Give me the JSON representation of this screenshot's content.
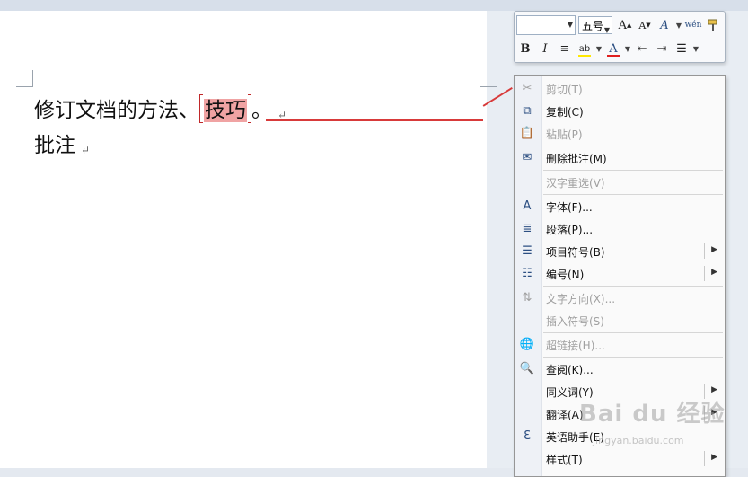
{
  "document": {
    "line1_before": "修订文档的方法、",
    "line1_highlight": "技巧",
    "line1_after": "。",
    "paragraph_mark": "↵",
    "line2": "批注"
  },
  "colors": {
    "comment_highlight": "#f0a3a3",
    "comment_line": "#d83a3a"
  },
  "mini_toolbar": {
    "font_name": "",
    "font_size": "五号",
    "grow_font": "A",
    "shrink_font": "A",
    "styles": "A",
    "phonetic": "wén",
    "format_painter_icon": "brush-icon",
    "bold": "B",
    "italic": "I",
    "center": "≡",
    "highlight": "ab",
    "font_color": "A",
    "decrease_indent": "⇤",
    "increase_indent": "⇥",
    "bullets": "☰"
  },
  "context_menu": {
    "items": [
      {
        "label": "剪切(T)",
        "icon": "scissors-icon",
        "glyph": "✂",
        "disabled": true
      },
      {
        "label": "复制(C)",
        "icon": "copy-icon",
        "glyph": "⧉",
        "disabled": false
      },
      {
        "label": "粘贴(P)",
        "icon": "paste-icon",
        "glyph": "📋",
        "disabled": true
      },
      {
        "label": "删除批注(M)",
        "icon": "delete-comment-icon",
        "glyph": "✉",
        "disabled": false
      },
      {
        "label": "汉字重选(V)",
        "icon": "",
        "glyph": "",
        "disabled": true
      },
      {
        "label": "字体(F)...",
        "icon": "font-icon",
        "glyph": "A",
        "disabled": false
      },
      {
        "label": "段落(P)...",
        "icon": "paragraph-icon",
        "glyph": "≣",
        "disabled": false
      },
      {
        "label": "项目符号(B)",
        "icon": "bullets-icon",
        "glyph": "☰",
        "disabled": false,
        "submenu": true
      },
      {
        "label": "编号(N)",
        "icon": "numbering-icon",
        "glyph": "☷",
        "disabled": false,
        "submenu": true
      },
      {
        "label": "文字方向(X)...",
        "icon": "text-direction-icon",
        "glyph": "⇅",
        "disabled": true
      },
      {
        "label": "插入符号(S)",
        "icon": "",
        "glyph": "",
        "disabled": true
      },
      {
        "label": "超链接(H)...",
        "icon": "hyperlink-icon",
        "glyph": "🌐",
        "disabled": true
      },
      {
        "label": "查阅(K)...",
        "icon": "lookup-icon",
        "glyph": "🔍",
        "disabled": false
      },
      {
        "label": "同义词(Y)",
        "icon": "",
        "glyph": "",
        "disabled": false,
        "submenu": true
      },
      {
        "label": "翻译(A)",
        "icon": "",
        "glyph": "",
        "disabled": false,
        "submenu": true
      },
      {
        "label": "英语助手(E)",
        "icon": "english-assistant-icon",
        "glyph": "Ɛ",
        "disabled": false
      },
      {
        "label": "样式(T)",
        "icon": "",
        "glyph": "",
        "disabled": false,
        "submenu": true
      }
    ]
  },
  "watermark": {
    "brand": "Bai du 经验",
    "url": "jingyan.baidu.com"
  }
}
